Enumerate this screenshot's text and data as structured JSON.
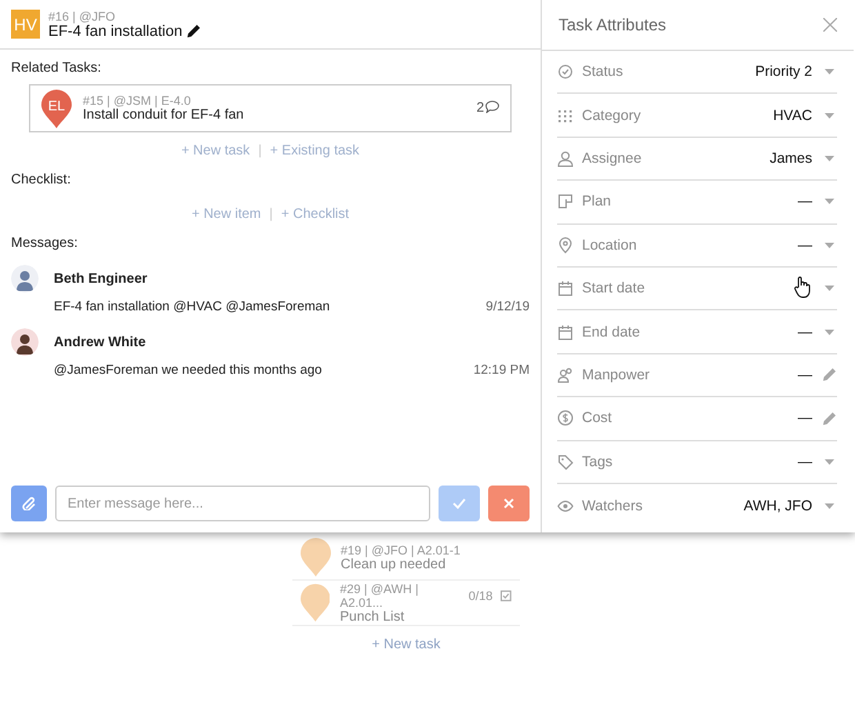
{
  "task": {
    "badge": "HV",
    "meta": "#16 | @JFO",
    "title": "EF-4 fan installation"
  },
  "related_tasks": {
    "label": "Related Tasks:",
    "items": [
      {
        "badge": "EL",
        "color": "#e2644f",
        "meta": "#15 | @JSM | E-4.0",
        "title": "Install conduit for EF-4 fan",
        "comments": "2"
      }
    ],
    "links": [
      "+ New task",
      "+ Existing task"
    ],
    "separator": "|"
  },
  "checklist": {
    "label": "Checklist:",
    "links": [
      "+ New item",
      "+ Checklist"
    ],
    "separator": "|"
  },
  "messages": {
    "label": "Messages:",
    "items": [
      {
        "author": "Beth Engineer",
        "text": "EF-4 fan installation @HVAC @JamesForeman",
        "time": "9/12/19"
      },
      {
        "author": "Andrew White",
        "text": "@JamesForeman we needed this months ago",
        "time": "12:19 PM"
      }
    ]
  },
  "composer": {
    "placeholder": "Enter message here..."
  },
  "attributes": {
    "title": "Task Attributes",
    "rows": [
      {
        "label": "Status",
        "value": "Priority 2",
        "kind": "dropdown",
        "hovered": false
      },
      {
        "label": "Category",
        "value": "HVAC",
        "kind": "dropdown",
        "hovered": false
      },
      {
        "label": "Assignee",
        "value": "James",
        "kind": "dropdown",
        "hovered": false
      },
      {
        "label": "Plan",
        "value": "—",
        "kind": "dropdown",
        "hovered": false
      },
      {
        "label": "Location",
        "value": "—",
        "kind": "dropdown",
        "hovered": false
      },
      {
        "label": "Start date",
        "kind": "dropdown",
        "hovered": true
      },
      {
        "label": "End date",
        "value": "—",
        "kind": "dropdown",
        "hovered": false
      },
      {
        "label": "Manpower",
        "value": "—",
        "kind": "edit",
        "hovered": false
      },
      {
        "label": "Cost",
        "value": "—",
        "kind": "edit",
        "hovered": false
      },
      {
        "label": "Tags",
        "value": "—",
        "kind": "dropdown",
        "hovered": false
      },
      {
        "label": "Watchers",
        "value": "AWH, JFO",
        "kind": "dropdown",
        "hovered": false
      }
    ]
  },
  "background_tasks": {
    "items": [
      {
        "color": "#f7d3aa",
        "meta": "#19 | @JFO | A2.01-1",
        "title": "Clean up needed"
      },
      {
        "color": "#f7d3aa",
        "meta": "#29 | @AWH | A2.01...",
        "title": "Punch List",
        "progress": "0/18"
      }
    ],
    "link": "+ New task"
  }
}
